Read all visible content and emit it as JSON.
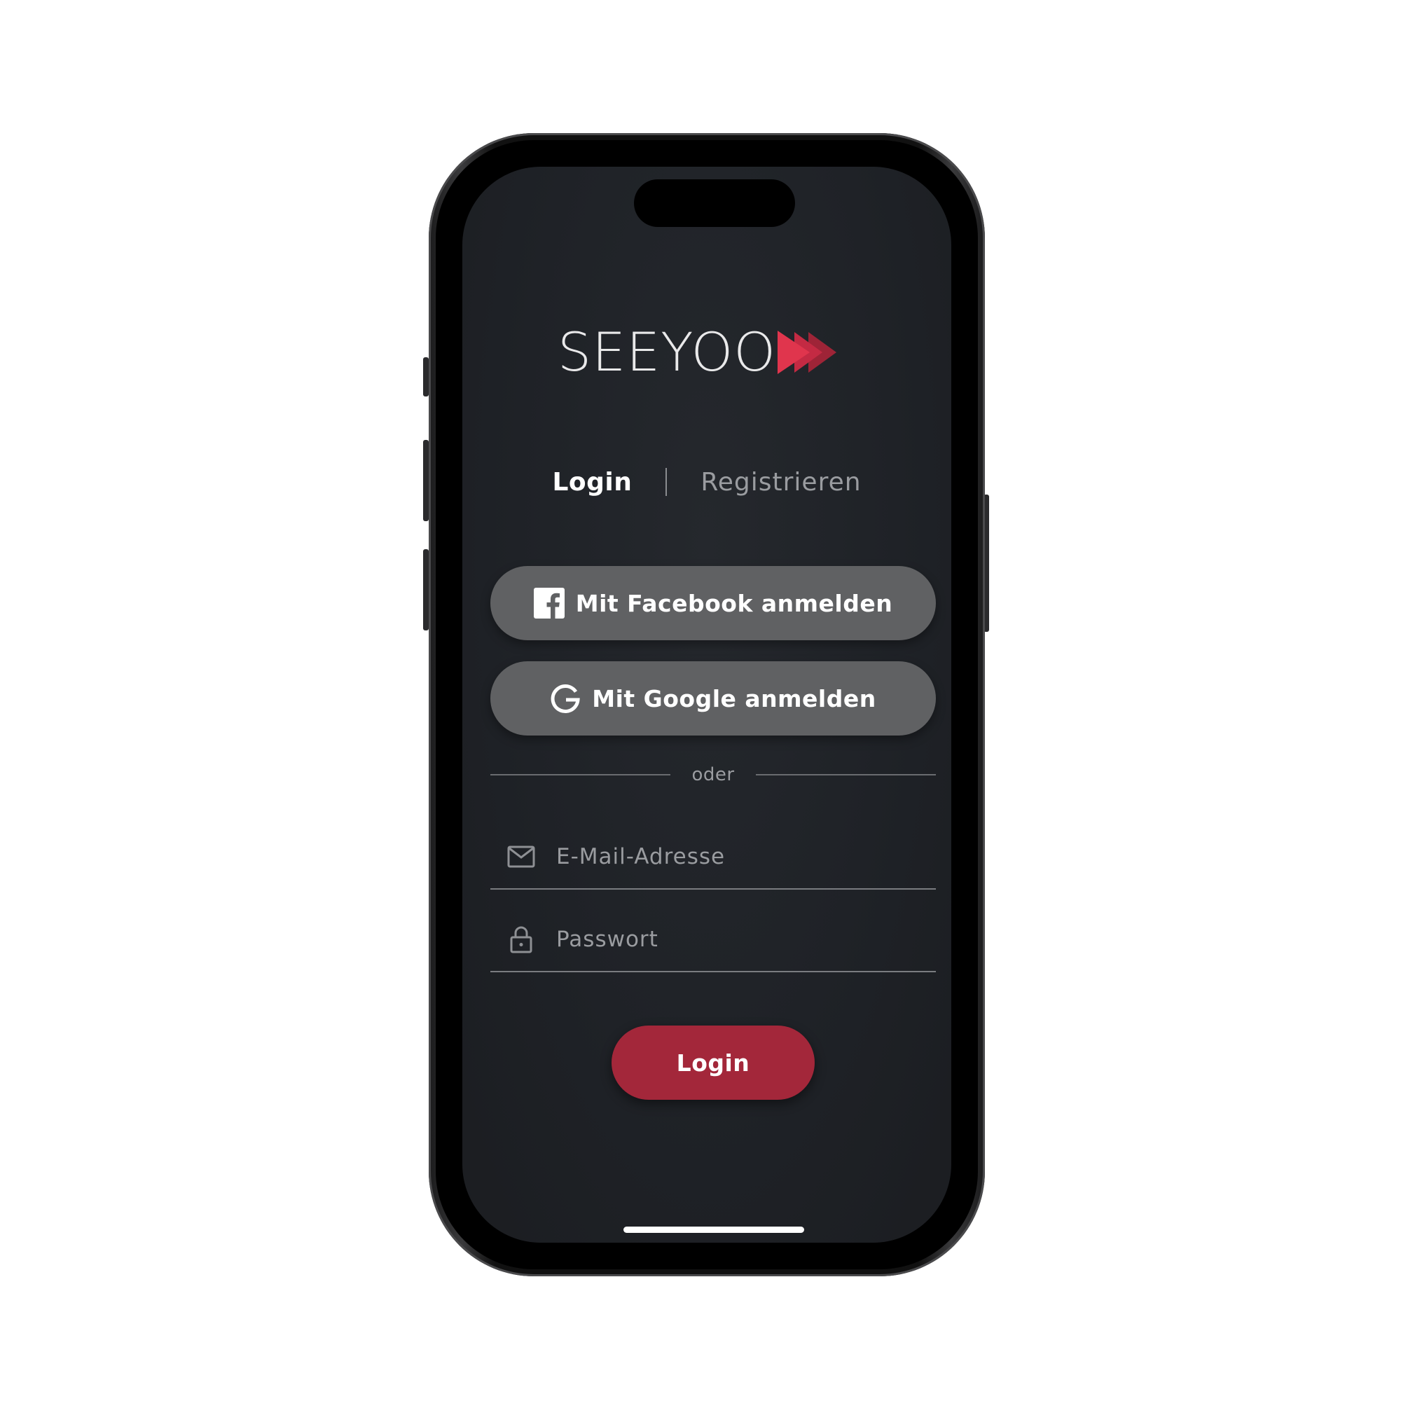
{
  "app": {
    "logo_text": "SEEYOO",
    "accent_color": "#e0354d",
    "screen_background": "#1f2227"
  },
  "tabs": [
    {
      "label": "Login",
      "active": true
    },
    {
      "label": "Registrieren",
      "active": false
    }
  ],
  "social": {
    "facebook_label": "Mit Facebook anmelden",
    "facebook_icon": "facebook-icon",
    "google_label": "Mit Google anmelden",
    "google_icon": "google-icon",
    "button_color": "#606163"
  },
  "divider": {
    "text": "oder"
  },
  "form": {
    "email": {
      "placeholder": "E-Mail-Adresse",
      "value": "",
      "icon": "mail-icon"
    },
    "password": {
      "placeholder": "Passwort",
      "value": "",
      "icon": "lock-icon"
    },
    "submit_label": "Login",
    "submit_color": "#a3273a"
  }
}
